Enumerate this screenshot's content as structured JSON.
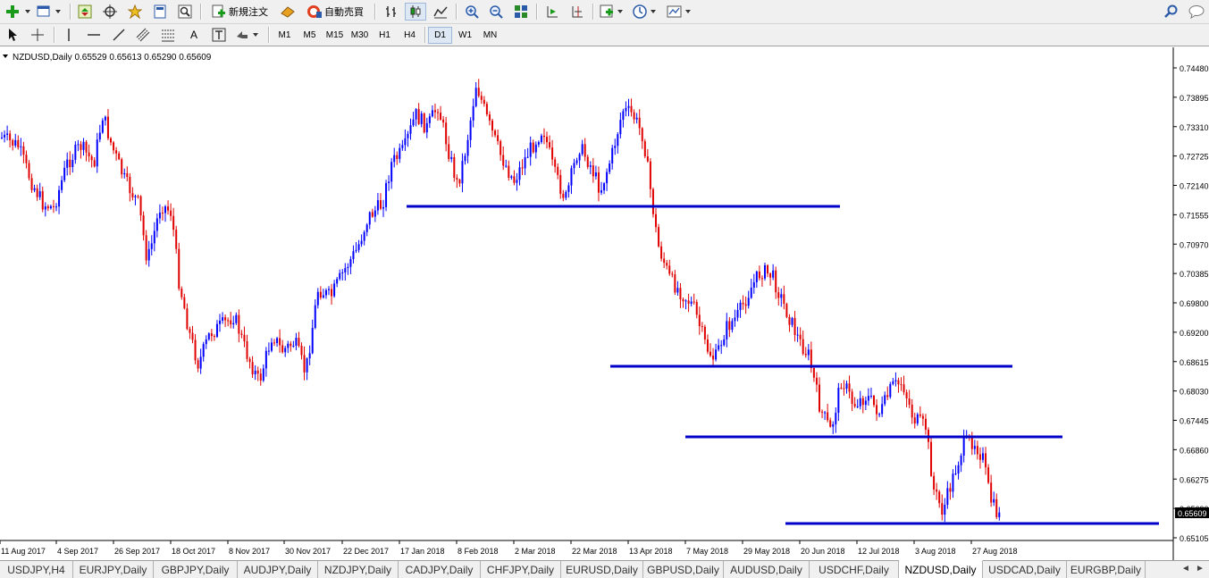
{
  "toolbar": {
    "new_order_label": "新規注文",
    "auto_trade_label": "自動売買"
  },
  "timeframes": [
    {
      "label": "M1",
      "active": false
    },
    {
      "label": "M5",
      "active": false
    },
    {
      "label": "M15",
      "active": false
    },
    {
      "label": "M30",
      "active": false
    },
    {
      "label": "H1",
      "active": false
    },
    {
      "label": "H4",
      "active": false
    },
    {
      "label": "D1",
      "active": true
    },
    {
      "label": "W1",
      "active": false
    },
    {
      "label": "MN",
      "active": false
    }
  ],
  "chart": {
    "header": "NZDUSD,Daily  0.65529 0.65613 0.65290 0.65609",
    "current_price": "0.65609",
    "price_labels": [
      "0.74480",
      "0.73895",
      "0.73310",
      "0.72725",
      "0.72140",
      "0.71555",
      "0.70970",
      "0.70385",
      "0.69800",
      "0.69200",
      "0.68615",
      "0.68030",
      "0.67445",
      "0.66860",
      "0.66275",
      "0.65690",
      "0.65105"
    ],
    "date_labels": [
      "11 Aug 2017",
      "4 Sep 2017",
      "26 Sep 2017",
      "18 Oct 2017",
      "8 Nov 2017",
      "30 Nov 2017",
      "22 Dec 2017",
      "17 Jan 2018",
      "8 Feb 2018",
      "2 Mar 2018",
      "22 Mar 2018",
      "13 Apr 2018",
      "7 May 2018",
      "29 May 2018",
      "20 Jun 2018",
      "12 Jul 2018",
      "3 Aug 2018",
      "27 Aug 2018"
    ],
    "colors": {
      "bull": "#0000ff",
      "bear": "#e00000",
      "line": "#0000c8"
    }
  },
  "symbol_tabs": [
    {
      "label": "USDJPY,H4",
      "active": false
    },
    {
      "label": "EURJPY,Daily",
      "active": false
    },
    {
      "label": "GBPJPY,Daily",
      "active": false
    },
    {
      "label": "AUDJPY,Daily",
      "active": false
    },
    {
      "label": "NZDJPY,Daily",
      "active": false
    },
    {
      "label": "CADJPY,Daily",
      "active": false
    },
    {
      "label": "CHFJPY,Daily",
      "active": false
    },
    {
      "label": "EURUSD,Daily",
      "active": false
    },
    {
      "label": "GBPUSD,Daily",
      "active": false
    },
    {
      "label": "AUDUSD,Daily",
      "active": false
    },
    {
      "label": "USDCHF,Daily",
      "active": false
    },
    {
      "label": "NZDUSD,Daily",
      "active": true
    },
    {
      "label": "USDCAD,Daily",
      "active": false
    },
    {
      "label": "EURGBP,Daily",
      "active": false
    }
  ]
}
